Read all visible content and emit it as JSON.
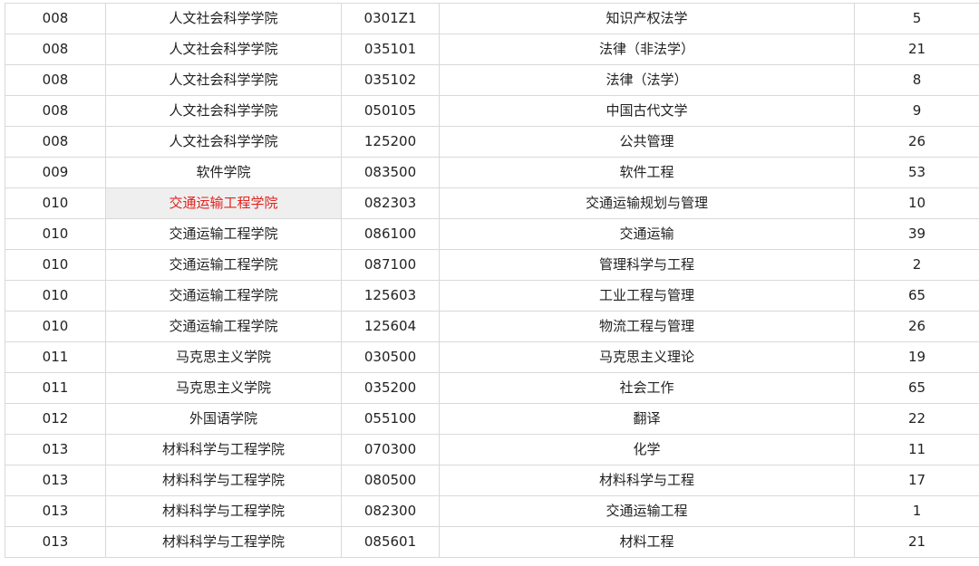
{
  "table": {
    "highlight_color": "#e0231e",
    "highlight_bg": "#efefef",
    "rows": [
      {
        "unit_code": "008",
        "college": "人文社会科学学院",
        "major_code": "0301Z1",
        "major": "知识产权法学",
        "count": "5"
      },
      {
        "unit_code": "008",
        "college": "人文社会科学学院",
        "major_code": "035101",
        "major": "法律（非法学）",
        "count": "21"
      },
      {
        "unit_code": "008",
        "college": "人文社会科学学院",
        "major_code": "035102",
        "major": "法律（法学）",
        "count": "8"
      },
      {
        "unit_code": "008",
        "college": "人文社会科学学院",
        "major_code": "050105",
        "major": "中国古代文学",
        "count": "9"
      },
      {
        "unit_code": "008",
        "college": "人文社会科学学院",
        "major_code": "125200",
        "major": "公共管理",
        "count": "26"
      },
      {
        "unit_code": "009",
        "college": "软件学院",
        "major_code": "083500",
        "major": "软件工程",
        "count": "53"
      },
      {
        "unit_code": "010",
        "college": "交通运输工程学院",
        "major_code": "082303",
        "major": "交通运输规划与管理",
        "count": "10",
        "college_highlighted": true
      },
      {
        "unit_code": "010",
        "college": "交通运输工程学院",
        "major_code": "086100",
        "major": "交通运输",
        "count": "39"
      },
      {
        "unit_code": "010",
        "college": "交通运输工程学院",
        "major_code": "087100",
        "major": "管理科学与工程",
        "count": "2"
      },
      {
        "unit_code": "010",
        "college": "交通运输工程学院",
        "major_code": "125603",
        "major": "工业工程与管理",
        "count": "65"
      },
      {
        "unit_code": "010",
        "college": "交通运输工程学院",
        "major_code": "125604",
        "major": "物流工程与管理",
        "count": "26"
      },
      {
        "unit_code": "011",
        "college": "马克思主义学院",
        "major_code": "030500",
        "major": "马克思主义理论",
        "count": "19"
      },
      {
        "unit_code": "011",
        "college": "马克思主义学院",
        "major_code": "035200",
        "major": "社会工作",
        "count": "65"
      },
      {
        "unit_code": "012",
        "college": "外国语学院",
        "major_code": "055100",
        "major": "翻译",
        "count": "22"
      },
      {
        "unit_code": "013",
        "college": "材料科学与工程学院",
        "major_code": "070300",
        "major": "化学",
        "count": "11"
      },
      {
        "unit_code": "013",
        "college": "材料科学与工程学院",
        "major_code": "080500",
        "major": "材料科学与工程",
        "count": "17"
      },
      {
        "unit_code": "013",
        "college": "材料科学与工程学院",
        "major_code": "082300",
        "major": "交通运输工程",
        "count": "1"
      },
      {
        "unit_code": "013",
        "college": "材料科学与工程学院",
        "major_code": "085601",
        "major": "材料工程",
        "count": "21"
      }
    ]
  }
}
